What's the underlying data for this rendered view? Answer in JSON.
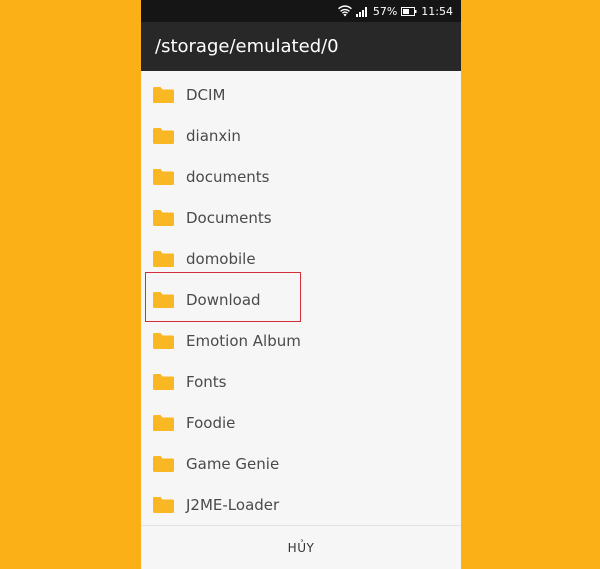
{
  "status_bar": {
    "battery_percent": "57%",
    "time": "11:54",
    "icons": [
      "wifi-icon",
      "signal-icon",
      "battery-icon"
    ]
  },
  "app_bar": {
    "path": "/storage/emulated/0"
  },
  "folders": [
    {
      "label": "DCIM"
    },
    {
      "label": "dianxin"
    },
    {
      "label": "documents"
    },
    {
      "label": "Documents"
    },
    {
      "label": "domobile"
    },
    {
      "label": "Download"
    },
    {
      "label": "Emotion Album"
    },
    {
      "label": "Fonts"
    },
    {
      "label": "Foodie"
    },
    {
      "label": "Game Genie"
    },
    {
      "label": "J2ME-Loader"
    }
  ],
  "footer": {
    "cancel_label": "HỦY"
  },
  "colors": {
    "background": "#fbb018",
    "folder": "#f9b723",
    "highlight": "#d32f3a",
    "app_bar": "#282828"
  }
}
